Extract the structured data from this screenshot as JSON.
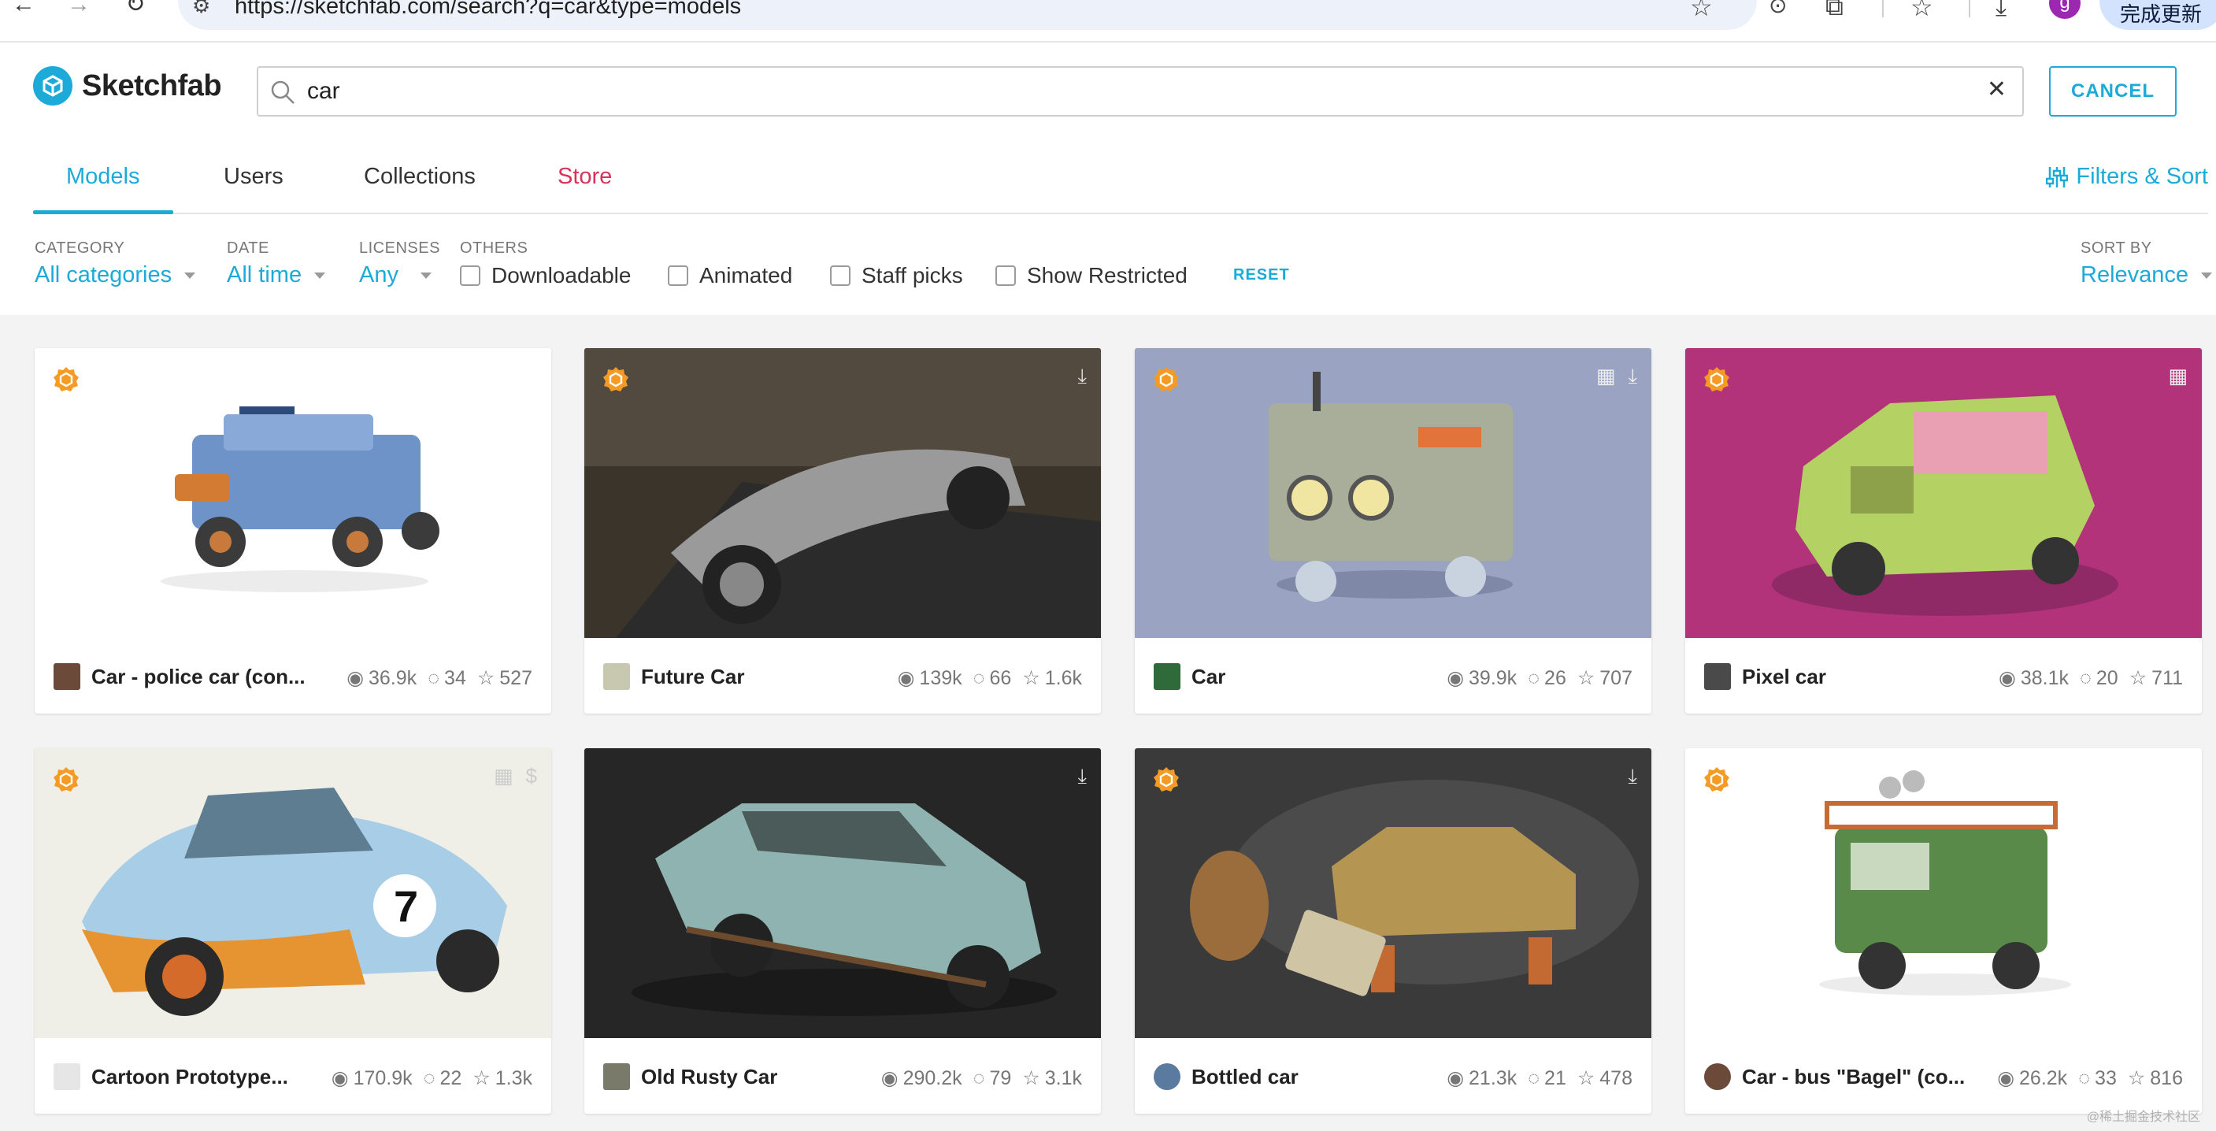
{
  "browser": {
    "url": "https://sketchfab.com/search?q=car&type=models",
    "avatar_letter": "g",
    "update_button": "完成更新",
    "icons": [
      "back-icon",
      "forward-icon",
      "reload-icon",
      "star-icon",
      "extensions-icon",
      "download-icon"
    ]
  },
  "header": {
    "brand": "Sketchfab",
    "search_value": "car",
    "cancel_label": "CANCEL"
  },
  "tabs": [
    {
      "label": "Models",
      "active": true
    },
    {
      "label": "Users"
    },
    {
      "label": "Collections"
    },
    {
      "label": "Store"
    }
  ],
  "filters_label": "Filters & Sort",
  "filter_bar": {
    "category": {
      "label": "CATEGORY",
      "value": "All categories"
    },
    "date": {
      "label": "DATE",
      "value": "All time"
    },
    "licenses": {
      "label": "LICENSES",
      "value": "Any"
    },
    "others_label": "OTHERS",
    "checkboxes": [
      "Downloadable",
      "Animated",
      "Staff picks",
      "Show Restricted"
    ],
    "reset_label": "RESET",
    "sort": {
      "label": "SORT BY",
      "value": "Relevance"
    }
  },
  "colors": {
    "accent": "#1caad9",
    "store": "#d8335b",
    "badge": "#f59b23"
  },
  "cards": [
    {
      "title": "Car - police car (con...",
      "views": "36.9k",
      "comments": "34",
      "likes": "527",
      "icons": []
    },
    {
      "title": "Future Car",
      "views": "139k",
      "comments": "66",
      "likes": "1.6k",
      "icons": [
        "download-icon"
      ]
    },
    {
      "title": "Car",
      "views": "39.9k",
      "comments": "26",
      "likes": "707",
      "icons": [
        "film-icon",
        "download-icon"
      ]
    },
    {
      "title": "Pixel car",
      "views": "38.1k",
      "comments": "20",
      "likes": "711",
      "icons": [
        "film-icon"
      ]
    },
    {
      "title": "Cartoon Prototype...",
      "views": "170.9k",
      "comments": "22",
      "likes": "1.3k",
      "icons": [
        "film-icon",
        "price-icon"
      ]
    },
    {
      "title": "Old Rusty Car",
      "views": "290.2k",
      "comments": "79",
      "likes": "3.1k",
      "icons": [
        "download-icon"
      ]
    },
    {
      "title": "Bottled car",
      "views": "21.3k",
      "comments": "21",
      "likes": "478",
      "icons": [
        "download-icon"
      ]
    },
    {
      "title": "Car - bus \"Bagel\" (co...",
      "views": "26.2k",
      "comments": "33",
      "likes": "816",
      "icons": []
    }
  ],
  "watermark": "@稀土掘金技术社区"
}
